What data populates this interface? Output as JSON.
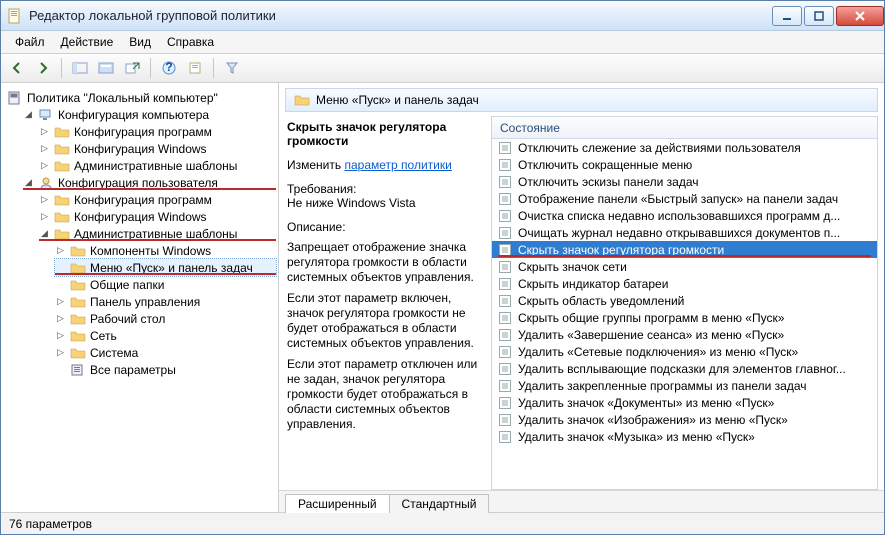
{
  "window": {
    "title": "Редактор локальной групповой политики"
  },
  "menubar": [
    "Файл",
    "Действие",
    "Вид",
    "Справка"
  ],
  "tree": {
    "root": "Политика \"Локальный компьютер\"",
    "computer": {
      "label": "Конфигурация компьютера",
      "children": [
        "Конфигурация программ",
        "Конфигурация Windows",
        "Административные шаблоны"
      ]
    },
    "user": {
      "label": "Конфигурация пользователя",
      "children": {
        "programs": "Конфигурация программ",
        "windows": "Конфигурация Windows",
        "admin": {
          "label": "Административные шаблоны",
          "children": [
            "Компоненты Windows",
            "Меню «Пуск» и панель задач",
            "Общие папки",
            "Панель управления",
            "Рабочий стол",
            "Сеть",
            "Система",
            "Все параметры"
          ]
        }
      }
    }
  },
  "path_strip": "Меню «Пуск» и панель задач",
  "detail": {
    "heading": "Скрыть значок регулятора громкости",
    "change_label": "Изменить",
    "change_link": "параметр политики",
    "req_label": "Требования:",
    "req_value": "Не ниже Windows Vista",
    "desc_label": "Описание:",
    "desc_p1": "Запрещает отображение значка регулятора громкости в области системных объектов управления.",
    "desc_p2": "Если этот параметр включен, значок регулятора громкости не будет отображаться в области системных объектов управления.",
    "desc_p3": "Если этот параметр отключен или не задан, значок регулятора громкости будет отображаться в области системных объектов управления."
  },
  "list": {
    "column": "Состояние",
    "items": [
      "Отключить слежение за действиями пользователя",
      "Отключить сокращенные меню",
      "Отключить эскизы панели задач",
      "Отображение панели «Быстрый запуск» на панели задач",
      "Очистка списка недавно использовавшихся программ д...",
      "Очищать журнал недавно открывавшихся документов п...",
      "Скрыть значок регулятора громкости",
      "Скрыть значок сети",
      "Скрыть индикатор батареи",
      "Скрыть область уведомлений",
      "Скрыть общие группы программ в меню «Пуск»",
      "Удалить «Завершение сеанса» из меню «Пуск»",
      "Удалить «Сетевые подключения» из меню «Пуск»",
      "Удалить всплывающие подсказки для элементов главног...",
      "Удалить закрепленные программы из панели задач",
      "Удалить значок «Документы» из меню «Пуск»",
      "Удалить значок «Изображения» из меню «Пуск»",
      "Удалить значок «Музыка» из меню «Пуск»"
    ],
    "selected_index": 6
  },
  "tabs": {
    "extended": "Расширенный",
    "standard": "Стандартный"
  },
  "status": "76 параметров"
}
